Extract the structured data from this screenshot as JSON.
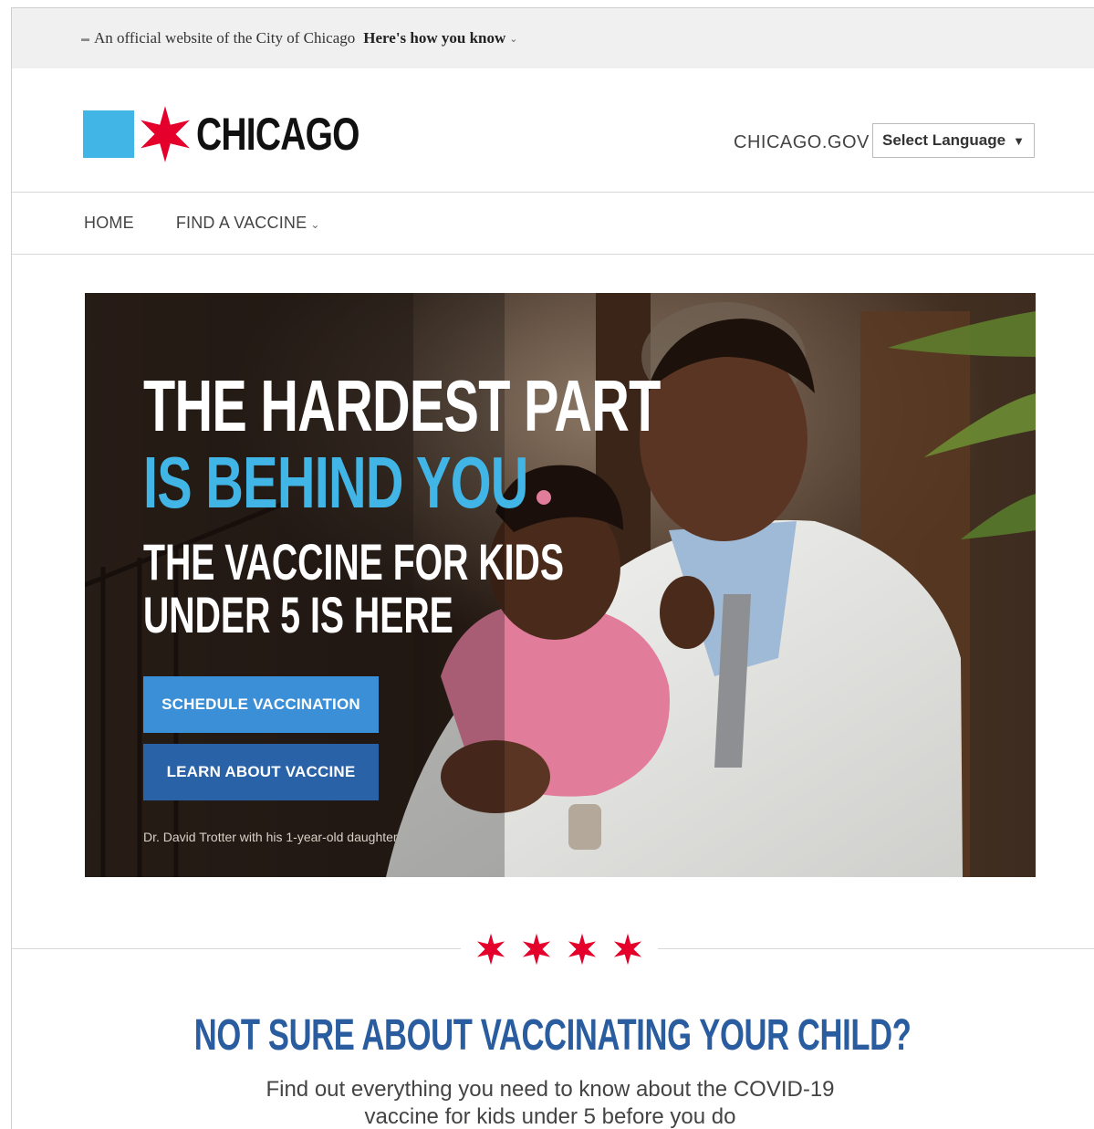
{
  "official_banner": {
    "text": "An official website of the City of Chicago",
    "link": "Here's how you know"
  },
  "header": {
    "logo_text": "CHICAGO",
    "site_link": "CHICAGO.GOV",
    "language_select": "Select Language"
  },
  "nav": {
    "items": [
      {
        "label": "HOME"
      },
      {
        "label": "FIND A VACCINE"
      }
    ]
  },
  "hero": {
    "headline_line1": "THE HARDEST PART",
    "headline_line2": "IS BEHIND YOU",
    "subhead_line1": "THE VACCINE FOR KIDS",
    "subhead_line2": "UNDER 5 IS HERE",
    "schedule_button": "SCHEDULE VACCINATION",
    "learn_button": "LEARN ABOUT VACCINE",
    "caption": "Dr. David Trotter with his 1-year-old daughter"
  },
  "section": {
    "title": "NOT SURE ABOUT VACCINATING YOUR CHILD?",
    "subtitle": "Find out everything you need to know about the COVID-19 vaccine for kids under 5 before you do"
  },
  "colors": {
    "brand_blue": "#41b6e6",
    "star_red": "#e4002b",
    "title_blue": "#2a5d9f",
    "button_blue": "#3a8fd6",
    "button_dark_blue": "#2a62a8"
  }
}
